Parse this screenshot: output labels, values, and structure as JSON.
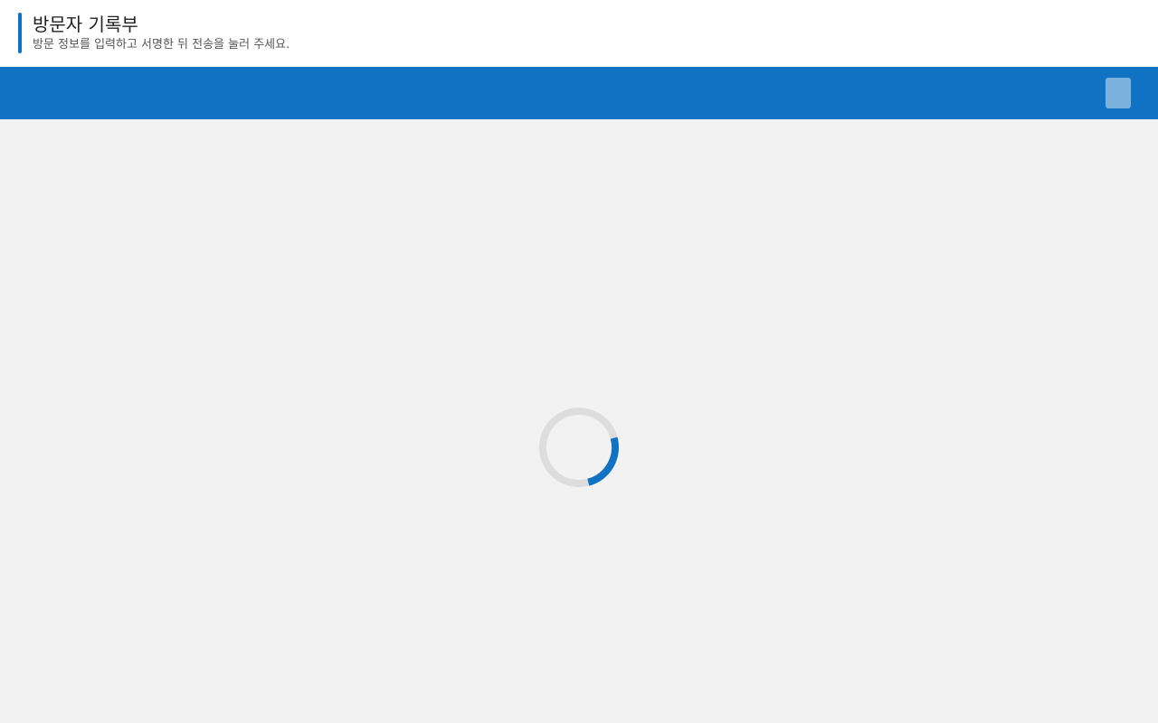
{
  "header": {
    "title": "방문자 기록부",
    "subtitle": "방문 정보를 입력하고 서명한 뒤 전송을 눌러 주세요."
  },
  "loading": {
    "progress": 0.25
  },
  "colors": {
    "brand": "#0f72c2",
    "background": "#f2f2f2",
    "spinner_track": "#dddddd"
  }
}
